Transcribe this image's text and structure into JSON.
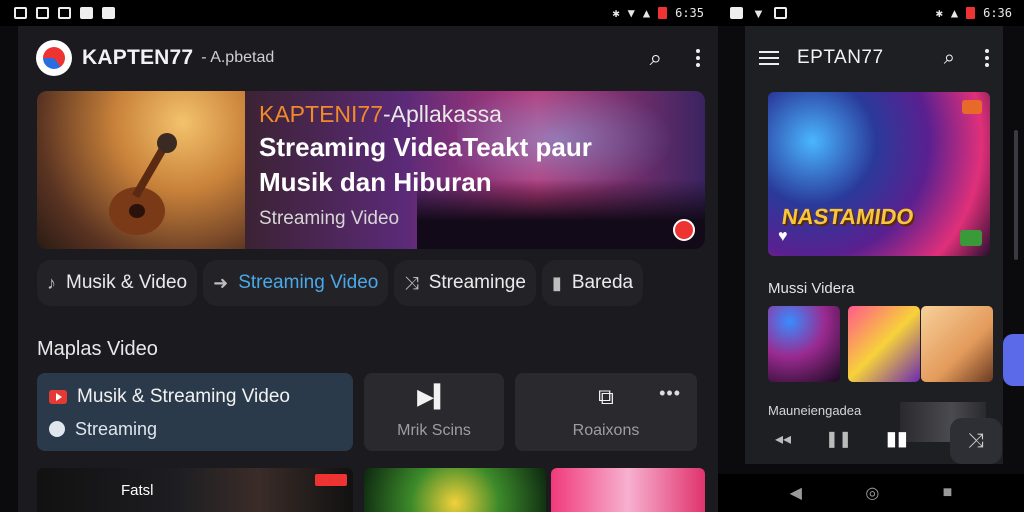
{
  "status_left": {
    "time": "6:35"
  },
  "status_right": {
    "time": "6:36"
  },
  "app": {
    "title": "KAPTEN77",
    "subtitle": "- A.pbetad",
    "search_icon": "search-icon",
    "more_icon": "more-vert-icon"
  },
  "hero": {
    "brand_accent": "KAPTENI77",
    "brand_rest": "-Apllakassa",
    "line1": "Streaming VideaTeakt paur",
    "line2": "Musik dan Hiburan",
    "sub": "Streaming Video"
  },
  "chips": [
    {
      "label": "Musik & Video",
      "icon": "music-icon"
    },
    {
      "label": "Streaming Video",
      "icon": "arrow-right-icon"
    },
    {
      "label": "Streaminge",
      "icon": "shuffle-icon"
    },
    {
      "label": "Bareda",
      "icon": "book-icon"
    }
  ],
  "section": {
    "title": "Maplas Video"
  },
  "cards": {
    "big_title": "Musik & Streaming Video",
    "big_sub": "Streaming",
    "c2": "Mrik Scins",
    "c3": "Roaixons"
  },
  "thumbs": {
    "t1_label": "Fatsl"
  },
  "side": {
    "title": "EPTAN77",
    "feature_title": "NASTAMIDO",
    "section": "Mussi Videra",
    "section2": "Mauneiengadea"
  },
  "colors": {
    "accent": "#4aa8e8",
    "brand": "#f08a2a",
    "bg": "#1b1b1f"
  }
}
